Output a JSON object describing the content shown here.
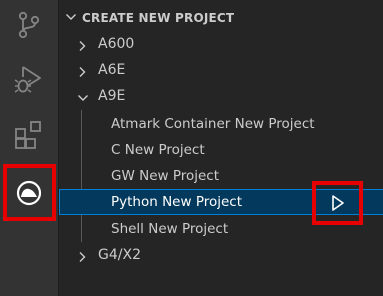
{
  "activity_bar": {
    "items": [
      {
        "name": "source-control-icon"
      },
      {
        "name": "run-debug-icon"
      },
      {
        "name": "extensions-icon"
      },
      {
        "name": "device-extension-icon",
        "highlighted": true
      }
    ],
    "highlight_color": "#e60000"
  },
  "explorer": {
    "section_title": "CREATE NEW PROJECT",
    "tree": [
      {
        "label": "A600",
        "level": 1,
        "expanded": false
      },
      {
        "label": "A6E",
        "level": 1,
        "expanded": false
      },
      {
        "label": "A9E",
        "level": 1,
        "expanded": true
      },
      {
        "label": "Atmark Container New Project",
        "level": 2
      },
      {
        "label": "C New Project",
        "level": 2
      },
      {
        "label": "GW New Project",
        "level": 2
      },
      {
        "label": "Python New Project",
        "level": 2,
        "selected": true,
        "action": "run-icon"
      },
      {
        "label": "Shell New Project",
        "level": 2
      },
      {
        "label": "G4/X2",
        "level": 1,
        "expanded": false
      }
    ]
  },
  "colors": {
    "activity_bar_bg": "#333333",
    "sidebar_bg": "#252526",
    "selected_row_bg": "#04395e",
    "selected_outline": "#007fd4",
    "annotation_red": "#e60000"
  }
}
